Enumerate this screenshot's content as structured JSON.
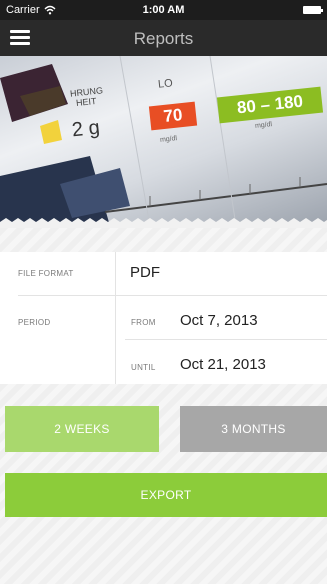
{
  "status_bar": {
    "carrier": "Carrier",
    "time": "1:00 AM"
  },
  "nav": {
    "title": "Reports",
    "menu_icon": "hamburger-menu-icon"
  },
  "hero": {
    "lo_label": "LO",
    "value": "70",
    "range": "80 – 180",
    "unit": "mg/dl",
    "word1": "HRUNG",
    "word2": "HEIT",
    "grams": "2 g"
  },
  "form": {
    "file_format_label": "FILE FORMAT",
    "file_format_value": "PDF",
    "period_label": "PERIOD",
    "from_label": "FROM",
    "from_value": "Oct 7, 2013",
    "until_label": "UNTIL",
    "until_value": "Oct 21, 2013"
  },
  "buttons": {
    "two_weeks": "2 WEEKS",
    "three_months": "3 MONTHS",
    "export": "EXPORT"
  },
  "colors": {
    "selected_green": "#a9d86d",
    "export_green": "#8ccc3a",
    "unselected_gray": "#a7a7a7",
    "red_badge": "#e84e24",
    "range_green": "#8cbd22"
  }
}
